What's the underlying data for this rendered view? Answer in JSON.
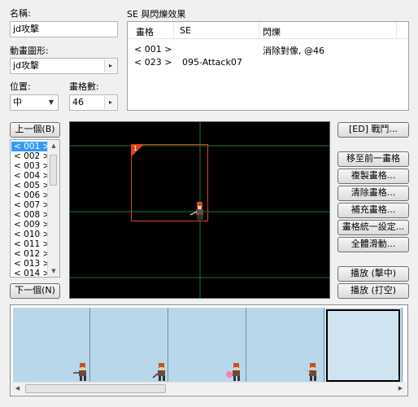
{
  "name": {
    "label": "名稱:",
    "value": "jd攻擊"
  },
  "anim_graphic": {
    "label": "動畫圖形:",
    "value": "jd攻擊"
  },
  "position": {
    "label": "位置:",
    "value": "中"
  },
  "frame_count": {
    "label": "畫格數:",
    "value": "46"
  },
  "se_panel": {
    "title": "SE 與閃爍效果",
    "headers": [
      "畫格",
      "SE",
      "閃爍"
    ],
    "rows": [
      {
        "frame": "< 001 >",
        "se": "",
        "flash": "消除對像, @46"
      },
      {
        "frame": "< 023 >",
        "se": "095-Attack07",
        "flash": ""
      }
    ]
  },
  "buttons": {
    "prev": "上一個(B)",
    "next": "下一個(N)",
    "battle": "[ED] 戰鬥...",
    "move_to_prev": "移至前一畫格",
    "copy": "複製畫格...",
    "clear": "清除畫格...",
    "fill": "補充畫格...",
    "unify": "畫格統一設定...",
    "slide": "全體滑動...",
    "play_hit": "播放 (擊中)",
    "play_miss": "播放 (打空)"
  },
  "frames": [
    "< 001 >",
    "< 002 >",
    "< 003 >",
    "< 004 >",
    "< 005 >",
    "< 006 >",
    "< 007 >",
    "< 008 >",
    "< 009 >",
    "< 010 >",
    "< 011 >",
    "< 012 >",
    "< 013 >",
    "< 014 >"
  ],
  "canvas": {
    "cell_number": "1"
  },
  "icons": {
    "dropdown": "chevron-down-icon",
    "spin": "spin-arrow-icon",
    "up": "scroll-up-icon",
    "down": "scroll-down-icon",
    "left": "scroll-left-icon",
    "right": "scroll-right-icon",
    "sprite": "warrior-sprite-icon"
  },
  "colors": {
    "selection": "#3399ff",
    "guide_line": "#1e7a2e",
    "cell_border": "#e04020",
    "timeline_cell": "#b9d7ea"
  }
}
